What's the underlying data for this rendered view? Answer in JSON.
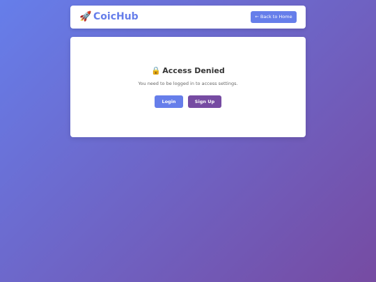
{
  "header": {
    "brand_icon": "🚀",
    "brand_icon_name": "rocket-icon",
    "brand_name": "CoicHub",
    "back_button_label": "← Back to Home"
  },
  "main": {
    "lock_icon": "🔒",
    "lock_icon_name": "lock-icon",
    "title": "Access Denied",
    "message": "You need to be logged in to access settings.",
    "login_label": "Login",
    "signup_label": "Sign Up"
  },
  "colors": {
    "gradient_start": "#667eea",
    "gradient_end": "#764ba2",
    "primary": "#667eea",
    "secondary": "#764ba2",
    "card_background": "#ffffff",
    "title_text": "#333333",
    "body_text": "#666666"
  }
}
